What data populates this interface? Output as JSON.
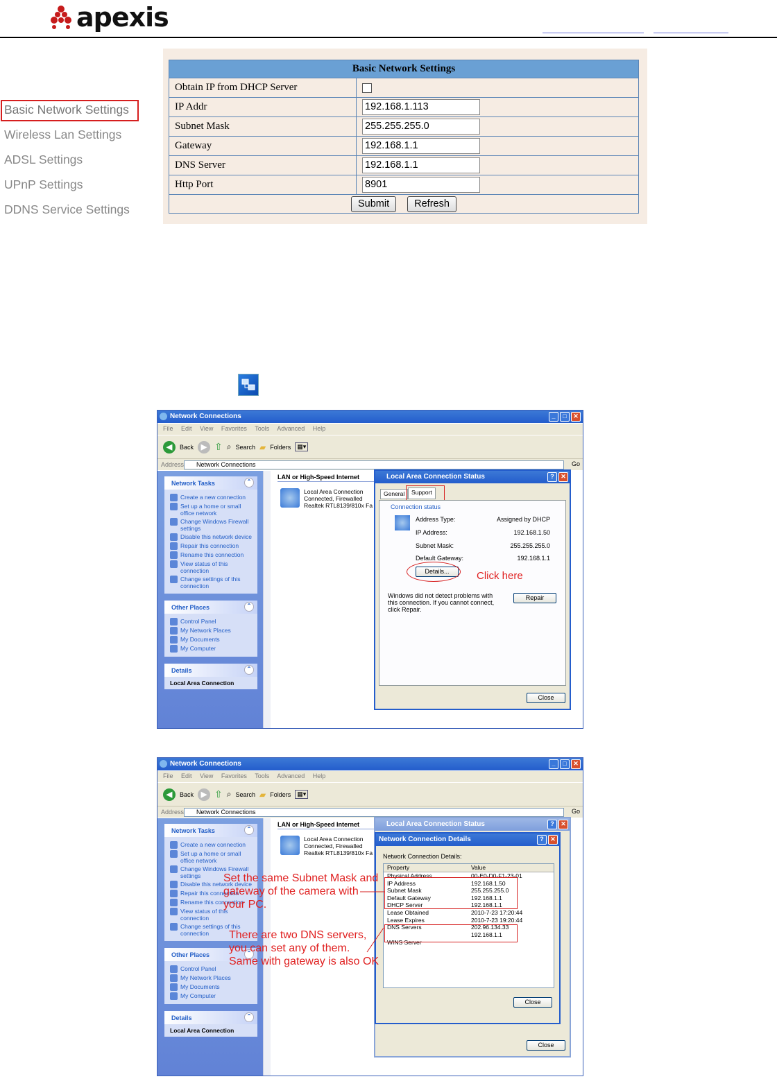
{
  "brand": {
    "logo_text": "apexis",
    "logo_color": "#c61b1b"
  },
  "nav": {
    "items": [
      {
        "label": "Basic Network Settings"
      },
      {
        "label": "Wireless Lan Settings"
      },
      {
        "label": "ADSL Settings"
      },
      {
        "label": "UPnP Settings"
      },
      {
        "label": "DDNS Service Settings"
      }
    ]
  },
  "settings": {
    "title": "Basic Network Settings",
    "dhcp_label": "Obtain IP from DHCP Server",
    "dhcp_checked": false,
    "ip_label": "IP Addr",
    "ip_value": "192.168.1.113",
    "mask_label": "Subnet Mask",
    "mask_value": "255.255.255.0",
    "gw_label": "Gateway",
    "gw_value": "192.168.1.1",
    "dns_label": "DNS Server",
    "dns_value": "192.168.1.1",
    "port_label": "Http Port",
    "port_value": "8901",
    "submit": "Submit",
    "refresh": "Refresh"
  },
  "xp": {
    "window_title": "Network Connections",
    "menu": "File Edit View Favorites Tools Advanced Help",
    "back": "Back",
    "search": "Search",
    "folders": "Folders",
    "address_label": "Address",
    "address_value": "Network Connections",
    "go": "Go",
    "network_tasks": "Network Tasks",
    "tasks": [
      "Create a new connection",
      "Set up a home or small office network",
      "Change Windows Firewall settings",
      "Disable this network device",
      "Repair this connection",
      "Rename this connection",
      "View status of this connection",
      "Change settings of this connection"
    ],
    "other_places": "Other Places",
    "places": [
      "Control Panel",
      "My Network Places",
      "My Documents",
      "My Computer"
    ],
    "details": "Details",
    "details_sub": "Local Area Connection",
    "group": "LAN or High-Speed Internet",
    "conn_name": "Local Area Connection",
    "conn_state": "Connected, Firewalled",
    "conn_dev": "Realtek RTL8139/810x Fa",
    "status_title": "Local Area Connection Status",
    "tab_general": "General",
    "tab_support": "Support",
    "conn_status": "Connection status",
    "addr_type_label": "Address Type:",
    "addr_type": "Assigned by DHCP",
    "ip_label": "IP Address:",
    "ip": "192.168.1.50",
    "mask_label": "Subnet Mask:",
    "mask": "255.255.255.0",
    "gw_label": "Default Gateway:",
    "gw": "192.168.1.1",
    "details_btn": "Details...",
    "click_here": "Click here",
    "windows_msg": "Windows did not detect problems with this connection. If you cannot connect, click Repair.",
    "repair": "Repair",
    "close": "Close",
    "details_title": "Network Connection Details",
    "details_caption": "Network Connection Details:",
    "col_property": "Property",
    "col_value": "Value",
    "rows": [
      {
        "p": "Physical Address",
        "v": "00-E0-D0-F1-23-01"
      },
      {
        "p": "IP Address",
        "v": "192.168.1.50"
      },
      {
        "p": "Subnet Mask",
        "v": "255.255.255.0"
      },
      {
        "p": "Default Gateway",
        "v": "192.168.1.1"
      },
      {
        "p": "DHCP Server",
        "v": "192.168.1.1"
      },
      {
        "p": "Lease Obtained",
        "v": "2010-7-23 17:20:44"
      },
      {
        "p": "Lease Expires",
        "v": "2010-7-23 19:20:44"
      },
      {
        "p": "DNS Servers",
        "v": "202.96.134.33"
      },
      {
        "p": "",
        "v": "192.168.1.1"
      },
      {
        "p": "WINS Server",
        "v": ""
      }
    ],
    "note1": "Set the same Subnet Mask and gateway of the camera with your PC.",
    "note1_l1": "Set the same Subnet Mask and",
    "note1_l2": "gateway of the camera with",
    "note1_l3": "your PC.",
    "note2_l1": "There are two DNS servers,",
    "note2_l2": "you can set any of them.",
    "note2_l3": "Same with gateway is also OK"
  }
}
